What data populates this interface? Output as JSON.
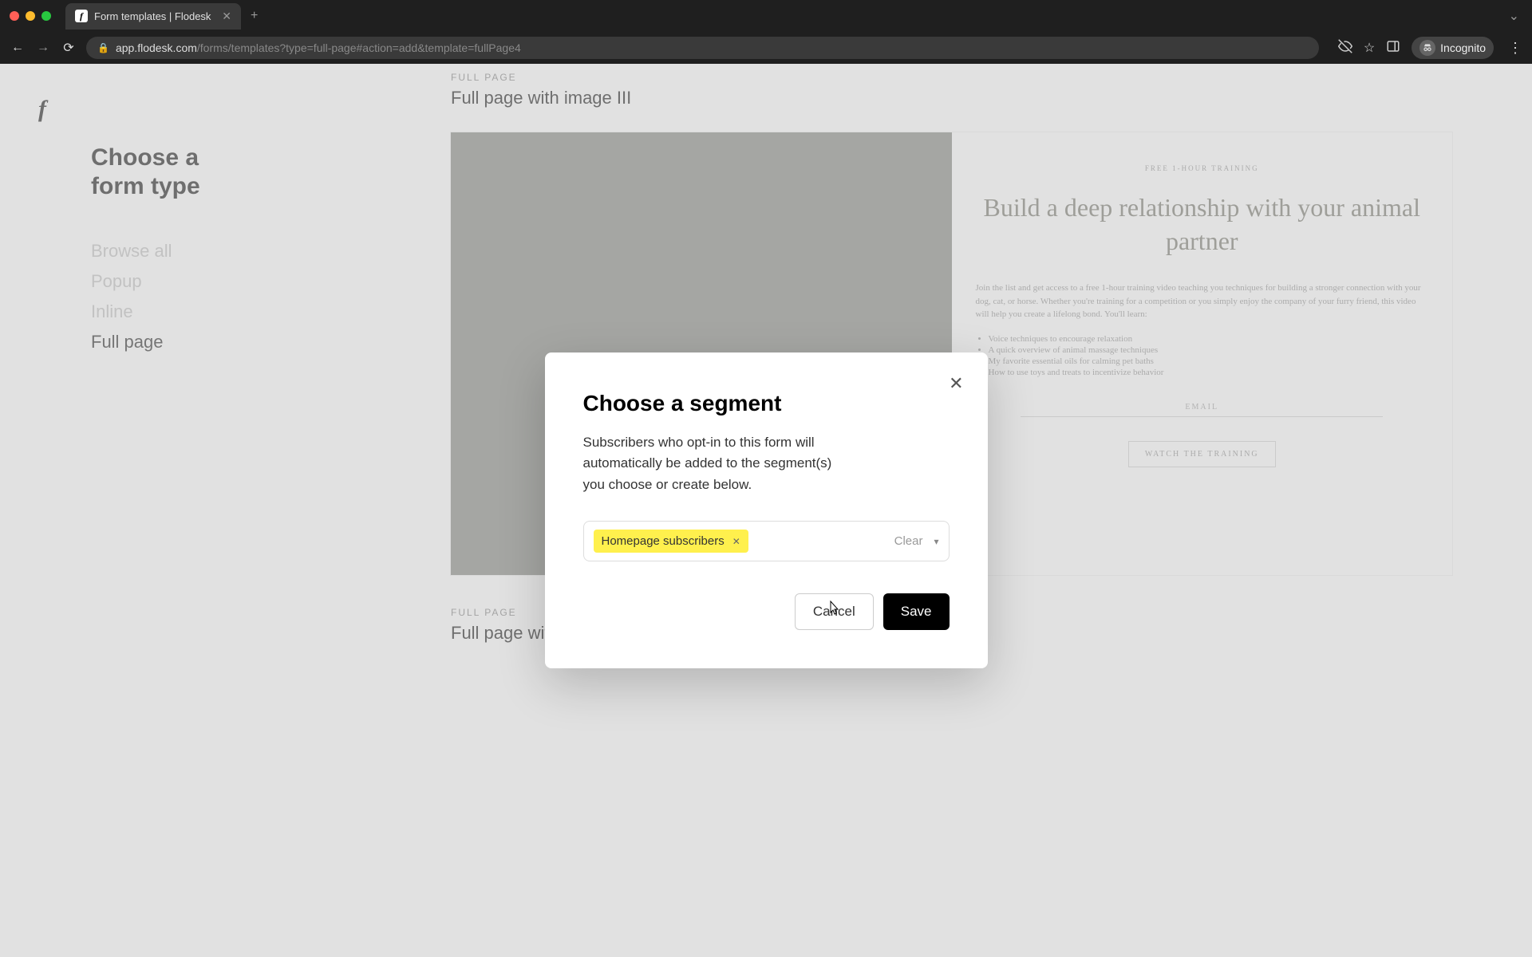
{
  "browser": {
    "tab_title": "Form templates | Flodesk",
    "url_host": "app.flodesk.com",
    "url_path": "/forms/templates?type=full-page#action=add&template=fullPage4",
    "incognito_label": "Incognito"
  },
  "sidebar": {
    "heading": "Choose a form type",
    "items": [
      {
        "label": "Browse all"
      },
      {
        "label": "Popup"
      },
      {
        "label": "Inline"
      },
      {
        "label": "Full page"
      }
    ],
    "active_index": 3
  },
  "templates": {
    "eyebrow": "FULL PAGE",
    "item3_title": "Full page with image III",
    "item4_title": "Full page with image IV",
    "preview": {
      "eyebrow": "FREE 1-HOUR TRAINING",
      "heading": "Build a deep relationship with your animal partner",
      "body": "Join the list and get access to a free 1-hour training video teaching you techniques for building a stronger connection with your dog, cat, or horse. Whether you're training for a competition or you simply enjoy the company of your furry friend, this video will help you create a lifelong bond. You'll learn:",
      "bullets": [
        "Voice techniques to encourage relaxation",
        "A quick overview of animal massage techniques",
        "My favorite essential oils for calming pet baths",
        "How to use toys and treats to incentivize behavior"
      ],
      "email_label": "EMAIL",
      "cta": "WATCH THE TRAINING"
    }
  },
  "modal": {
    "title": "Choose a segment",
    "description": "Subscribers who opt-in to this form will automatically be added to the segment(s) you choose or create below.",
    "selected_segment": "Homepage subscribers",
    "clear_label": "Clear",
    "cancel_label": "Cancel",
    "save_label": "Save"
  }
}
